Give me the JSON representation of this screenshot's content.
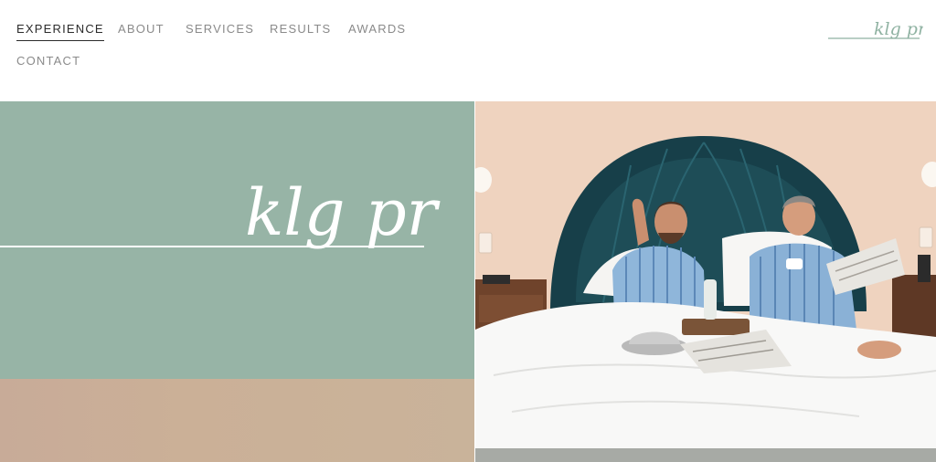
{
  "nav": {
    "items": [
      {
        "label": "EXPERIENCE",
        "active": true
      },
      {
        "label": "ABOUT",
        "active": false
      },
      {
        "label": "SERVICES",
        "active": false
      },
      {
        "label": "RESULTS",
        "active": false
      },
      {
        "label": "AWARDS",
        "active": false
      },
      {
        "label": "CONTACT",
        "active": false
      }
    ]
  },
  "brand": {
    "logo_text": "klg pr",
    "logo_color": "#8fb2a2"
  },
  "hero": {
    "panel_color": "#97b4a6",
    "logo_text": "klg pr",
    "photo_alt": "Two men in striped pajamas in bed with room service and newspapers"
  },
  "colors": {
    "nav_active": "#2b2b2b",
    "nav_inactive": "#8a8a8a",
    "tan_panel": "#c9ae98"
  }
}
